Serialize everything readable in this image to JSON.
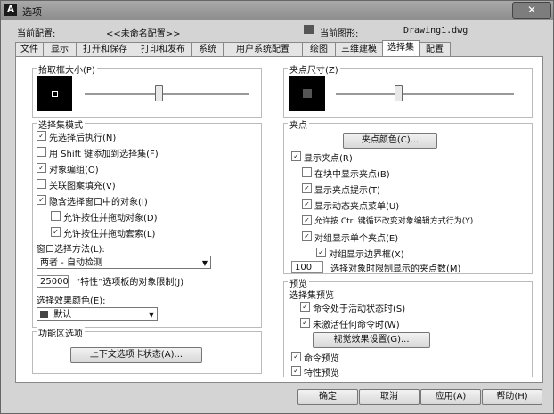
{
  "window": {
    "title": "选项",
    "close_label": "✕"
  },
  "profile": {
    "label": "当前配置:",
    "value": "<<未命名配置>>",
    "drawing_label": "当前图形:",
    "drawing_value": "Drawing1.dwg"
  },
  "tabs": [
    "文件",
    "显示",
    "打开和保存",
    "打印和发布",
    "系统",
    "用户系统配置",
    "绘图",
    "三维建模",
    "选择集",
    "配置"
  ],
  "pickbox": {
    "label": "拾取框大小(P)",
    "level": 0.45
  },
  "grip_size": {
    "label": "夹点尺寸(Z)",
    "level": 0.35
  },
  "selection_modes": {
    "label": "选择集模式",
    "items": [
      {
        "label": "先选择后执行(N)",
        "checked": true
      },
      {
        "label": "用 Shift 键添加到选择集(F)",
        "checked": false
      },
      {
        "label": "对象编组(O)",
        "checked": true
      },
      {
        "label": "关联图案填充(V)",
        "checked": false
      },
      {
        "label": "隐含选择窗口中的对象(I)",
        "checked": true
      },
      {
        "label": "允许按住并拖动对象(D)",
        "checked": false
      },
      {
        "label": "允许按住并拖动套索(L)",
        "checked": true
      }
    ],
    "window_method_label": "窗口选择方法(L):",
    "window_method_value": "两者 - 自动检测",
    "limit_value": "25000",
    "limit_label": "“特性”选项板的对象限制(J)",
    "effect_color_label": "选择效果颜色(E):",
    "effect_color_value": "默认"
  },
  "ribbon": {
    "label": "功能区选项",
    "button": "上下文选项卡状态(A)..."
  },
  "grips": {
    "label": "夹点",
    "color_button": "夹点颜色(C)...",
    "items": [
      {
        "label": "显示夹点(R)",
        "checked": true
      },
      {
        "label": "在块中显示夹点(B)",
        "checked": false
      },
      {
        "label": "显示夹点提示(T)",
        "checked": true
      },
      {
        "label": "显示动态夹点菜单(U)",
        "checked": true
      },
      {
        "label": "允许按 Ctrl 键循环改变对象编辑方式行为(Y)",
        "checked": true
      },
      {
        "label": "对组显示单个夹点(E)",
        "checked": true
      },
      {
        "label": "对组显示边界框(X)",
        "checked": true
      }
    ],
    "limit_value": "100",
    "limit_label": "选择对象时限制显示的夹点数(M)"
  },
  "preview": {
    "label": "预览",
    "sub_label": "选择集预览",
    "items": [
      {
        "label": "命令处于活动状态时(S)",
        "checked": true
      },
      {
        "label": "未激活任何命令时(W)",
        "checked": true
      }
    ],
    "effects_button": "视觉效果设置(G)...",
    "extra": [
      {
        "label": "命令预览",
        "checked": true
      },
      {
        "label": "特性预览",
        "checked": true
      }
    ]
  },
  "footer": {
    "ok": "确定",
    "cancel": "取消",
    "apply": "应用(A)",
    "help": "帮助(H)"
  }
}
